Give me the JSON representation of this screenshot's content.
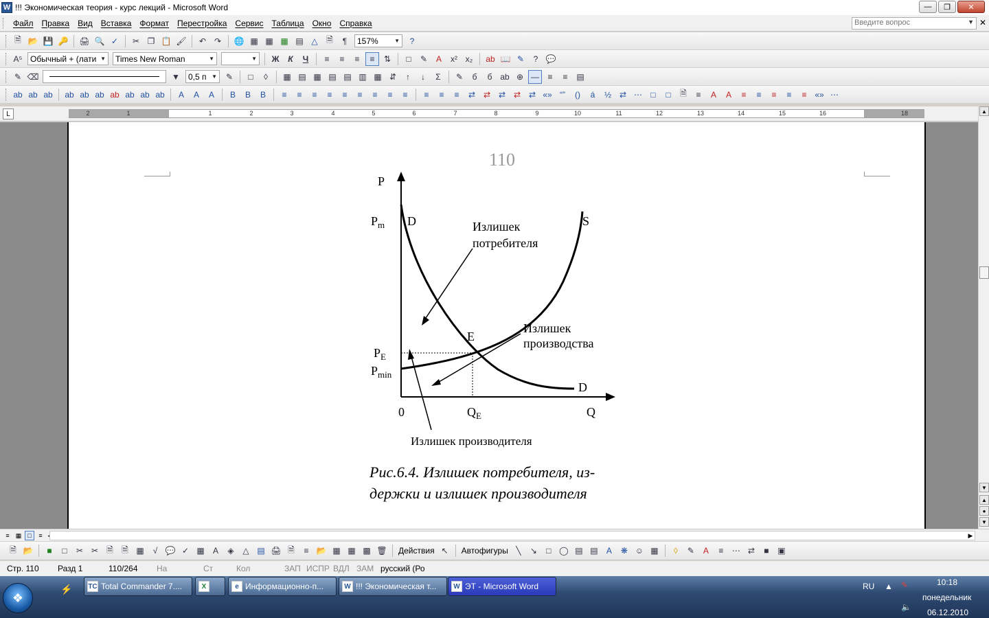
{
  "window": {
    "title": "!!! Экономическая теория - курс лекций - Microsoft Word",
    "app_icon": "W"
  },
  "menu": {
    "items": [
      "Файл",
      "Правка",
      "Вид",
      "Вставка",
      "Формат",
      "Перестройка",
      "Сервис",
      "Таблица",
      "Окно",
      "Справка"
    ],
    "ask_placeholder": "Введите вопрос"
  },
  "toolbar": {
    "zoom": "157%",
    "style": "Обычный + (лати",
    "font": "Times New Roman",
    "line_width": "0,5 п"
  },
  "ruler": {
    "numbers": [
      "2",
      "1",
      "1",
      "2",
      "3",
      "4",
      "5",
      "6",
      "7",
      "8",
      "9",
      "10",
      "11",
      "12",
      "13",
      "14",
      "15",
      "16",
      "18"
    ]
  },
  "document": {
    "page_number": "110",
    "figure": {
      "axis_p": "P",
      "axis_q": "Q",
      "origin": "0",
      "pm_base": "P",
      "pm_sub": "m",
      "pe_base": "P",
      "pe_sub": "E",
      "pmin_base": "P",
      "pmin_sub": "min",
      "qe_base": "Q",
      "qe_sub": "E",
      "d_top": "D",
      "d_bottom": "D",
      "s_label": "S",
      "e_label": "E",
      "consumer_surplus_line1": "Излишек",
      "consumer_surplus_line2": "потребителя",
      "producer_surplus_line1": "Излишек",
      "producer_surplus_line2": "производства",
      "producer_surplus_bottom": "Излишек производителя"
    },
    "caption_line1": "Рис.6.4. Излишек потребителя, из-",
    "caption_line2": "держки и излишек производителя"
  },
  "drawbar": {
    "actions": "Действия",
    "autoshapes": "Автофигуры"
  },
  "status": {
    "page": "Стр. 110",
    "section": "Разд 1",
    "pages": "110/264",
    "at": "На",
    "line": "Ст",
    "col": "Кол",
    "rec": "ЗАП",
    "trk": "ИСПР",
    "ext": "ВДЛ",
    "ovr": "ЗАМ",
    "lang": "русский (Ро"
  },
  "taskbar": {
    "tasks": [
      {
        "label": "Total Commander 7....",
        "icon": "TC"
      },
      {
        "label": "",
        "icon": "X"
      },
      {
        "label": "Информационно-п...",
        "icon": "e"
      },
      {
        "label": "!!! Экономическая т...",
        "icon": "W"
      },
      {
        "label": "ЭТ - Microsoft Word",
        "icon": "W"
      }
    ],
    "lang": "RU",
    "time": "10:18",
    "day": "понедельник",
    "date": "06.12.2010"
  }
}
